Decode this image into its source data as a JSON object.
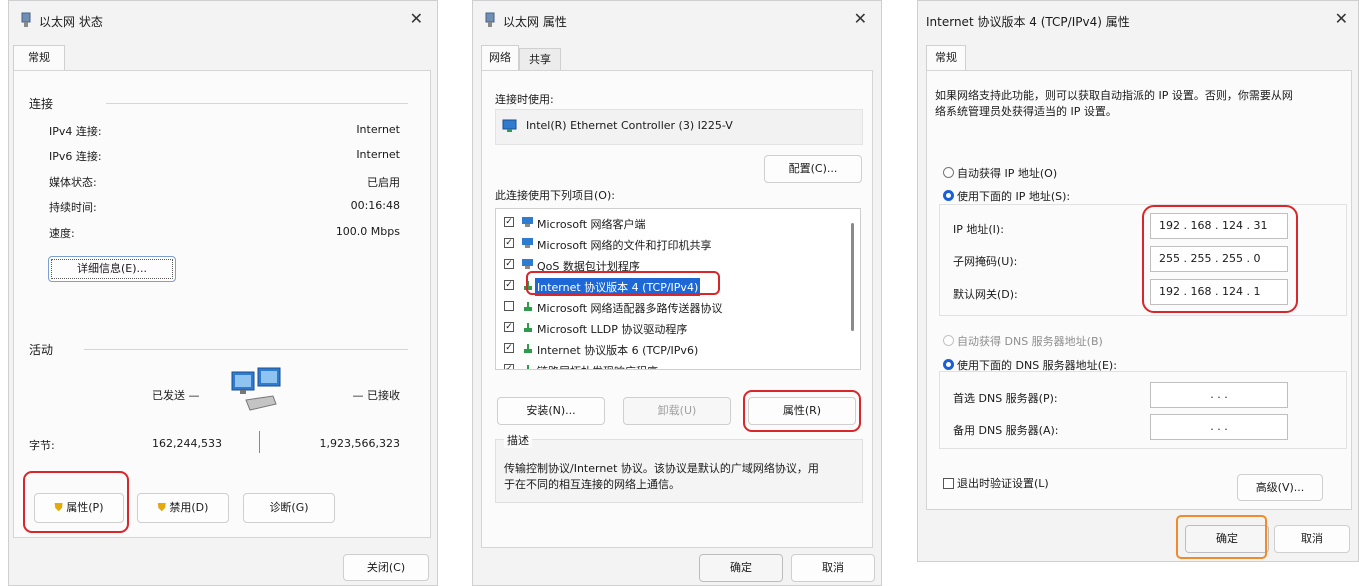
{
  "status": {
    "title": "以太网 状态",
    "tab_general": "常规",
    "section_connection": "连接",
    "rows": [
      {
        "label": "IPv4 连接:",
        "value": "Internet"
      },
      {
        "label": "IPv6 连接:",
        "value": "Internet"
      },
      {
        "label": "媒体状态:",
        "value": "已启用"
      },
      {
        "label": "持续时间:",
        "value": "00:16:48"
      },
      {
        "label": "速度:",
        "value": "100.0 Mbps"
      }
    ],
    "details_button": "详细信息(E)...",
    "section_activity": "活动",
    "sent": "已发送 —",
    "received": "— 已接收",
    "bytes_label": "字节:",
    "bytes_sent": "162,244,533",
    "bytes_received": "1,923,566,323",
    "properties_button": "属性(P)",
    "disable_button": "禁用(D)",
    "diagnose_button": "诊断(G)",
    "close_button": "关闭(C)"
  },
  "properties": {
    "title": "以太网 属性",
    "tab_network": "网络",
    "tab_sharing": "共享",
    "connect_using_label": "连接时使用:",
    "adapter": "Intel(R) Ethernet Controller (3) I225-V",
    "configure_button": "配置(C)...",
    "items_label": "此连接使用下列项目(O):",
    "items": [
      {
        "label": "Microsoft 网络客户端",
        "checked": true,
        "selected": false
      },
      {
        "label": "Microsoft 网络的文件和打印机共享",
        "checked": true,
        "selected": false
      },
      {
        "label": "QoS 数据包计划程序",
        "checked": true,
        "selected": false
      },
      {
        "label": "Internet 协议版本 4 (TCP/IPv4)",
        "checked": true,
        "selected": true
      },
      {
        "label": "Microsoft 网络适配器多路传送器协议",
        "checked": false,
        "selected": false
      },
      {
        "label": "Microsoft LLDP 协议驱动程序",
        "checked": true,
        "selected": false
      },
      {
        "label": "Internet 协议版本 6 (TCP/IPv6)",
        "checked": true,
        "selected": false
      },
      {
        "label": "链路层拓扑发现响应程序",
        "checked": true,
        "selected": false
      }
    ],
    "install_button": "安装(N)...",
    "uninstall_button": "卸载(U)",
    "properties_button": "属性(R)",
    "description_label": "描述",
    "description_text_1": "传输控制协议/Internet 协议。该协议是默认的广域网络协议，用",
    "description_text_2": "于在不同的相互连接的网络上通信。",
    "ok_button": "确定",
    "cancel_button": "取消"
  },
  "ipv4": {
    "title": "Internet 协议版本 4 (TCP/IPv4) 属性",
    "tab_general": "常规",
    "intro_1": "如果网络支持此功能，则可以获取自动指派的 IP 设置。否则，你需要从网",
    "intro_2": "络系统管理员处获得适当的 IP 设置。",
    "auto_ip": "自动获得 IP 地址(O)",
    "manual_ip": "使用下面的 IP 地址(S):",
    "ip_label": "IP 地址(I):",
    "ip_value": "192 . 168 . 124 . 31",
    "mask_label": "子网掩码(U):",
    "mask_value": "255 . 255 . 255 . 0",
    "gateway_label": "默认网关(D):",
    "gateway_value": "192 . 168 . 124 . 1",
    "auto_dns": "自动获得 DNS 服务器地址(B)",
    "manual_dns": "使用下面的 DNS 服务器地址(E):",
    "pref_dns_label": "首选 DNS 服务器(P):",
    "pref_dns_value": ".       .       .",
    "alt_dns_label": "备用 DNS 服务器(A):",
    "alt_dns_value": ".       .       .",
    "validate_label": "退出时验证设置(L)",
    "advanced_button": "高级(V)...",
    "ok_button": "确定",
    "cancel_button": "取消"
  },
  "colors": {
    "highlight_red": "#d9262b",
    "highlight_orange": "#f08a2c",
    "selection_blue": "#1d68d6"
  }
}
